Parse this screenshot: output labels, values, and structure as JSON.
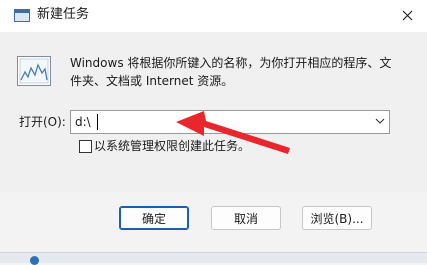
{
  "window": {
    "title": "新建任务",
    "close_icon": "close-icon"
  },
  "content": {
    "description": "Windows 将根据你所键入的名称，为你打开相应的程序、文件夹、文档或 Internet 资源。",
    "run_icon": "run-program-icon"
  },
  "open_field": {
    "label": "打开(O):",
    "value": "d:\\",
    "dropdown_icon": "chevron-down-icon"
  },
  "admin_checkbox": {
    "label": "以系统管理权限创建此任务。",
    "checked": false
  },
  "buttons": {
    "ok": "确定",
    "cancel": "取消",
    "browse": "浏览(B)..."
  },
  "colors": {
    "annotation_arrow": "#e8262b",
    "default_button_border": "#1a5fb4"
  }
}
